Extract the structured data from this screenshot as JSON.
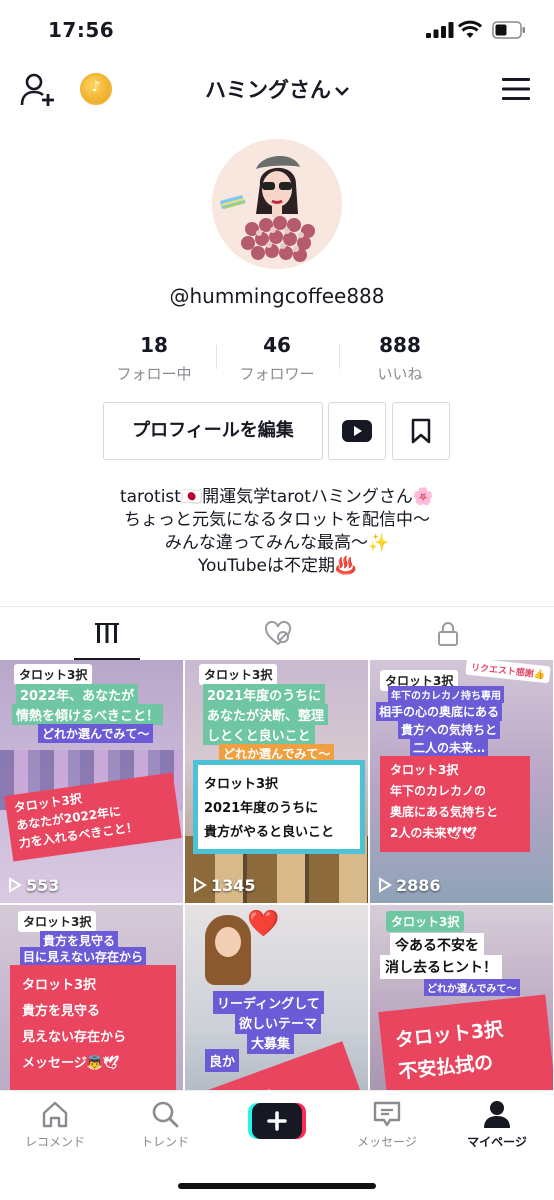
{
  "status_bar": {
    "time": "17:56"
  },
  "header": {
    "title": "ハミングさん"
  },
  "profile": {
    "username": "@hummingcoffee888",
    "stats": [
      {
        "value": "18",
        "label": "フォロー中"
      },
      {
        "value": "46",
        "label": "フォロワー"
      },
      {
        "value": "888",
        "label": "いいね"
      }
    ],
    "edit_button": "プロフィールを編集",
    "bio": [
      "tarotist🇯🇵開運気学tarotハミングさん🌸",
      "ちょっと元気になるタロットを配信中〜",
      "みんな違ってみんな最高〜✨",
      "YouTubeは不定期♨️"
    ]
  },
  "videos": [
    {
      "chip": "タロット3択",
      "caption1": "2022年、あなたが",
      "caption2": "情熱を傾けるべきこと！",
      "sub": "どれか選んでみて〜",
      "box": [
        "タロット3択",
        "あなたが2022年に",
        "力を入れるべきこと！"
      ],
      "views": "553"
    },
    {
      "chip": "タロット3択",
      "caption1": "2021年度のうちに",
      "caption2": "あなたが決断、整理",
      "caption3": "しとくと良いこと",
      "sub": "どれか選んでみて〜",
      "box": [
        "タロット3択",
        "2021年度のうちに",
        "貴方がやると良いこと"
      ],
      "views": "1345"
    },
    {
      "chip": "タロット3択",
      "badge": "リクエスト感謝👍",
      "small": "年下のカレカノ持ち専用",
      "caption1": "相手の心の奥底にある",
      "caption2": "貴方への気持ちと",
      "caption3": "二人の未来…",
      "box": [
        "タロット3択",
        "年下のカレカノの",
        "奥底にある気持ちと",
        "2人の未来🕊🕊"
      ],
      "views": "2886"
    },
    {
      "chip": "タロット3択",
      "caption1": "貴方を見守る",
      "caption2": "目に見えない存在から",
      "box": [
        "タロット3択",
        "貴方を見守る",
        "見えない存在から",
        "メッセージ👼🕊"
      ]
    },
    {
      "heart": "❤️",
      "caption1": "リーディングして",
      "caption2": "欲しいテーマ",
      "caption3": "大募集",
      "caption4": "良か",
      "box": [
        "タロット"
      ]
    },
    {
      "chip": "タロット3択",
      "caption1": "今ある不安を",
      "caption2": "消し去るヒント！",
      "sub": "どれか選んでみて〜",
      "box": [
        "タロット3択",
        "不安払拭の"
      ]
    }
  ],
  "bottom_nav": [
    {
      "label": "レコメンド",
      "icon": "home-icon"
    },
    {
      "label": "トレンド",
      "icon": "search-icon"
    },
    {
      "label": "",
      "icon": "plus-icon"
    },
    {
      "label": "メッセージ",
      "icon": "message-icon"
    },
    {
      "label": "マイページ",
      "icon": "profile-icon"
    }
  ]
}
